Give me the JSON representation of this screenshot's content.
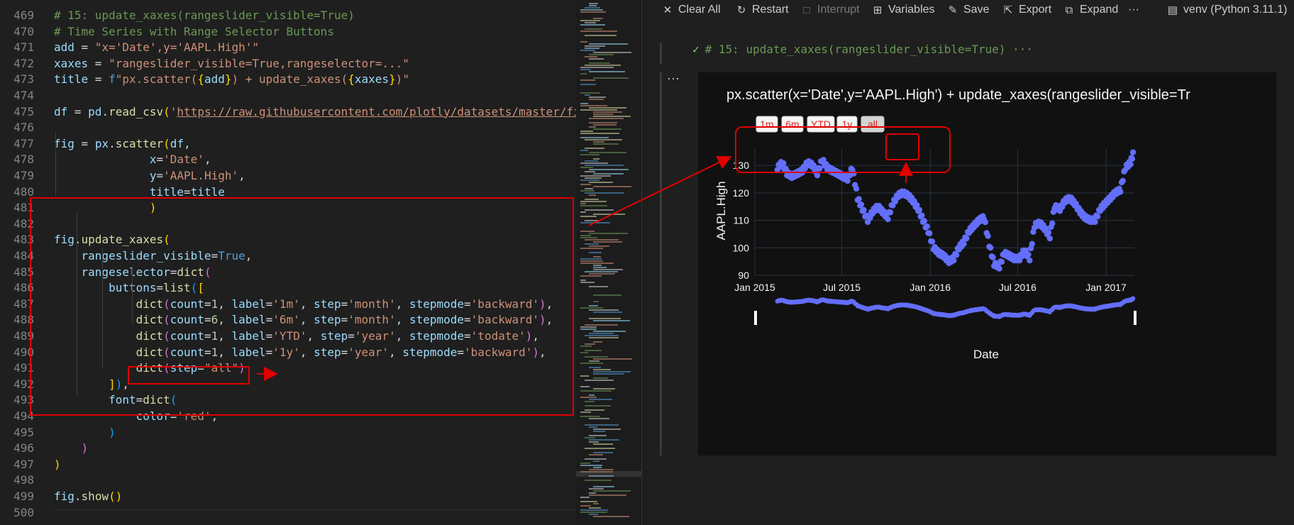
{
  "editor": {
    "lines": [
      {
        "n": "469",
        "tokens": [
          [
            "c-com",
            "# 15: update_xaxes(rangeslider_visible=True)"
          ]
        ]
      },
      {
        "n": "470",
        "tokens": [
          [
            "c-com",
            "# Time Series with Range Selector Buttons"
          ]
        ]
      },
      {
        "n": "471",
        "tokens": [
          [
            "c-var",
            "add"
          ],
          [
            "c-op",
            " = "
          ],
          [
            "c-str",
            "\"x='Date',y='AAPL.High'\""
          ]
        ]
      },
      {
        "n": "472",
        "tokens": [
          [
            "c-var",
            "xaxes"
          ],
          [
            "c-op",
            " = "
          ],
          [
            "c-str",
            "\"rangeslider_visible=True,rangeselector=...\""
          ]
        ]
      },
      {
        "n": "473",
        "tokens": [
          [
            "c-var",
            "title"
          ],
          [
            "c-op",
            " = "
          ],
          [
            "c-kw",
            "f"
          ],
          [
            "c-str",
            "\"px.scatter("
          ],
          [
            "c-br1",
            "{"
          ],
          [
            "c-var",
            "add"
          ],
          [
            "c-br1",
            "}"
          ],
          [
            "c-str",
            ") + update_xaxes("
          ],
          [
            "c-br1",
            "{"
          ],
          [
            "c-var",
            "xaxes"
          ],
          [
            "c-br1",
            "}"
          ],
          [
            "c-str",
            ")\""
          ]
        ]
      },
      {
        "n": "474",
        "tokens": []
      },
      {
        "n": "475",
        "tokens": [
          [
            "c-var",
            "df"
          ],
          [
            "c-op",
            " = "
          ],
          [
            "c-var",
            "pd"
          ],
          [
            "c-op",
            "."
          ],
          [
            "c-fn",
            "read_csv"
          ],
          [
            "c-br1",
            "("
          ],
          [
            "c-str",
            "'"
          ],
          [
            "c-url",
            "https://raw.githubusercontent.com/plotly/datasets/master/finan"
          ]
        ]
      },
      {
        "n": "476",
        "tokens": []
      },
      {
        "n": "477",
        "tokens": [
          [
            "c-var",
            "fig"
          ],
          [
            "c-op",
            " = "
          ],
          [
            "c-var",
            "px"
          ],
          [
            "c-op",
            "."
          ],
          [
            "c-fn",
            "scatter"
          ],
          [
            "c-br1",
            "("
          ],
          [
            "c-var",
            "df"
          ],
          [
            "c-op",
            ","
          ]
        ]
      },
      {
        "n": "478",
        "tokens": [
          [
            "c-op",
            "              "
          ],
          [
            "c-var",
            "x"
          ],
          [
            "c-op",
            "="
          ],
          [
            "c-str",
            "'Date'"
          ],
          [
            "c-op",
            ","
          ]
        ]
      },
      {
        "n": "479",
        "tokens": [
          [
            "c-op",
            "              "
          ],
          [
            "c-var",
            "y"
          ],
          [
            "c-op",
            "="
          ],
          [
            "c-str",
            "'AAPL.High'"
          ],
          [
            "c-op",
            ","
          ]
        ]
      },
      {
        "n": "480",
        "tokens": [
          [
            "c-op",
            "              "
          ],
          [
            "c-var",
            "title"
          ],
          [
            "c-op",
            "="
          ],
          [
            "c-var",
            "title"
          ]
        ]
      },
      {
        "n": "481",
        "tokens": [
          [
            "c-op",
            "              "
          ],
          [
            "c-br1",
            ")"
          ]
        ]
      },
      {
        "n": "482",
        "tokens": []
      },
      {
        "n": "483",
        "tokens": [
          [
            "c-var",
            "fig"
          ],
          [
            "c-op",
            "."
          ],
          [
            "c-fn",
            "update_xaxes"
          ],
          [
            "c-br1",
            "("
          ]
        ]
      },
      {
        "n": "484",
        "tokens": [
          [
            "c-op",
            "    "
          ],
          [
            "c-var",
            "rangeslider_visible"
          ],
          [
            "c-op",
            "="
          ],
          [
            "c-kw",
            "True"
          ],
          [
            "c-op",
            ","
          ]
        ]
      },
      {
        "n": "485",
        "tokens": [
          [
            "c-op",
            "    "
          ],
          [
            "c-var",
            "rangeselector"
          ],
          [
            "c-op",
            "="
          ],
          [
            "c-fn",
            "dict"
          ],
          [
            "c-br2",
            "("
          ]
        ]
      },
      {
        "n": "486",
        "tokens": [
          [
            "c-op",
            "        "
          ],
          [
            "c-var",
            "buttons"
          ],
          [
            "c-op",
            "="
          ],
          [
            "c-fn",
            "list"
          ],
          [
            "c-br3",
            "("
          ],
          [
            "c-br1",
            "["
          ]
        ]
      },
      {
        "n": "487",
        "tokens": [
          [
            "c-op",
            "            "
          ],
          [
            "c-fn",
            "dict"
          ],
          [
            "c-br2",
            "("
          ],
          [
            "c-var",
            "count"
          ],
          [
            "c-op",
            "="
          ],
          [
            "c-num",
            "1"
          ],
          [
            "c-op",
            ", "
          ],
          [
            "c-var",
            "label"
          ],
          [
            "c-op",
            "="
          ],
          [
            "c-str",
            "'1m'"
          ],
          [
            "c-op",
            ", "
          ],
          [
            "c-var",
            "step"
          ],
          [
            "c-op",
            "="
          ],
          [
            "c-str",
            "'month'"
          ],
          [
            "c-op",
            ", "
          ],
          [
            "c-var",
            "stepmode"
          ],
          [
            "c-op",
            "="
          ],
          [
            "c-str",
            "'backward'"
          ],
          [
            "c-br2",
            ")"
          ],
          [
            "c-op",
            ","
          ]
        ]
      },
      {
        "n": "488",
        "tokens": [
          [
            "c-op",
            "            "
          ],
          [
            "c-fn",
            "dict"
          ],
          [
            "c-br2",
            "("
          ],
          [
            "c-var",
            "count"
          ],
          [
            "c-op",
            "="
          ],
          [
            "c-num",
            "6"
          ],
          [
            "c-op",
            ", "
          ],
          [
            "c-var",
            "label"
          ],
          [
            "c-op",
            "="
          ],
          [
            "c-str",
            "'6m'"
          ],
          [
            "c-op",
            ", "
          ],
          [
            "c-var",
            "step"
          ],
          [
            "c-op",
            "="
          ],
          [
            "c-str",
            "'month'"
          ],
          [
            "c-op",
            ", "
          ],
          [
            "c-var",
            "stepmode"
          ],
          [
            "c-op",
            "="
          ],
          [
            "c-str",
            "'backward'"
          ],
          [
            "c-br2",
            ")"
          ],
          [
            "c-op",
            ","
          ]
        ]
      },
      {
        "n": "489",
        "tokens": [
          [
            "c-op",
            "            "
          ],
          [
            "c-fn",
            "dict"
          ],
          [
            "c-br2",
            "("
          ],
          [
            "c-var",
            "count"
          ],
          [
            "c-op",
            "="
          ],
          [
            "c-num",
            "1"
          ],
          [
            "c-op",
            ", "
          ],
          [
            "c-var",
            "label"
          ],
          [
            "c-op",
            "="
          ],
          [
            "c-str",
            "'YTD'"
          ],
          [
            "c-op",
            ", "
          ],
          [
            "c-var",
            "step"
          ],
          [
            "c-op",
            "="
          ],
          [
            "c-str",
            "'year'"
          ],
          [
            "c-op",
            ", "
          ],
          [
            "c-var",
            "stepmode"
          ],
          [
            "c-op",
            "="
          ],
          [
            "c-str",
            "'todate'"
          ],
          [
            "c-br2",
            ")"
          ],
          [
            "c-op",
            ","
          ]
        ]
      },
      {
        "n": "490",
        "tokens": [
          [
            "c-op",
            "            "
          ],
          [
            "c-fn",
            "dict"
          ],
          [
            "c-br2",
            "("
          ],
          [
            "c-var",
            "count"
          ],
          [
            "c-op",
            "="
          ],
          [
            "c-num",
            "1"
          ],
          [
            "c-op",
            ", "
          ],
          [
            "c-var",
            "label"
          ],
          [
            "c-op",
            "="
          ],
          [
            "c-str",
            "'1y'"
          ],
          [
            "c-op",
            ", "
          ],
          [
            "c-var",
            "step"
          ],
          [
            "c-op",
            "="
          ],
          [
            "c-str",
            "'year'"
          ],
          [
            "c-op",
            ", "
          ],
          [
            "c-var",
            "stepmode"
          ],
          [
            "c-op",
            "="
          ],
          [
            "c-str",
            "'backward'"
          ],
          [
            "c-br2",
            ")"
          ],
          [
            "c-op",
            ","
          ]
        ]
      },
      {
        "n": "491",
        "tokens": [
          [
            "c-op",
            "            "
          ],
          [
            "c-fn",
            "dict"
          ],
          [
            "c-br2",
            "("
          ],
          [
            "c-var",
            "step"
          ],
          [
            "c-op",
            "="
          ],
          [
            "c-str",
            "\"all\""
          ],
          [
            "c-br2",
            ")"
          ]
        ]
      },
      {
        "n": "492",
        "tokens": [
          [
            "c-op",
            "        "
          ],
          [
            "c-br1",
            "]"
          ],
          [
            "c-br3",
            ")"
          ],
          [
            "c-op",
            ","
          ]
        ]
      },
      {
        "n": "493",
        "tokens": [
          [
            "c-op",
            "        "
          ],
          [
            "c-var",
            "font"
          ],
          [
            "c-op",
            "="
          ],
          [
            "c-fn",
            "dict"
          ],
          [
            "c-br3",
            "("
          ]
        ]
      },
      {
        "n": "494",
        "tokens": [
          [
            "c-op",
            "            "
          ],
          [
            "c-var",
            "color"
          ],
          [
            "c-op",
            "="
          ],
          [
            "c-str",
            "'red'"
          ],
          [
            "c-op",
            ","
          ]
        ]
      },
      {
        "n": "495",
        "tokens": [
          [
            "c-op",
            "        "
          ],
          [
            "c-br3",
            ")"
          ]
        ]
      },
      {
        "n": "496",
        "tokens": [
          [
            "c-op",
            "    "
          ],
          [
            "c-br2",
            ")"
          ]
        ]
      },
      {
        "n": "497",
        "tokens": [
          [
            "c-br1",
            ")"
          ]
        ]
      },
      {
        "n": "498",
        "tokens": []
      },
      {
        "n": "499",
        "tokens": [
          [
            "c-var",
            "fig"
          ],
          [
            "c-op",
            "."
          ],
          [
            "c-fn",
            "show"
          ],
          [
            "c-br1",
            "()"
          ]
        ]
      },
      {
        "n": "500",
        "tokens": []
      }
    ]
  },
  "toolbar": {
    "clear_all": "Clear All",
    "restart": "Restart",
    "interrupt": "Interrupt",
    "variables": "Variables",
    "save": "Save",
    "export": "Export",
    "expand": "Expand",
    "more": "···",
    "kernel": "venv (Python 3.11.1)"
  },
  "cell": {
    "status_icon": "check-icon",
    "header": "# 15: update_xaxes(rangeslider_visible=True) ···",
    "output_menu": "···"
  },
  "colors": {
    "marker": "#636efa",
    "button_text": "#e02020",
    "annotation": "#e00000",
    "plot_bg": "#111111",
    "grid": "#283442"
  },
  "chart_data": {
    "type": "scatter",
    "title": "px.scatter(x='Date',y='AAPL.High') + update_xaxes(rangeslider_visible=Tr",
    "xlabel": "Date",
    "ylabel": "AAPL.High",
    "xlim": [
      "2015-01-01",
      "2017-03-01"
    ],
    "ylim": [
      90,
      136
    ],
    "x_ticks": [
      "Jan 2015",
      "Jul 2015",
      "Jan 2016",
      "Jul 2016",
      "Jan 2017"
    ],
    "y_ticks": [
      90,
      100,
      110,
      120,
      130
    ],
    "range_buttons": [
      "1m",
      "6m",
      "YTD",
      "1y",
      "all"
    ],
    "active_button": "all",
    "rangeslider_visible": true,
    "series": [
      {
        "x": [
          "2015-02-17",
          "2015-02-27",
          "2015-03-09",
          "2015-03-19",
          "2015-03-31",
          "2015-04-10",
          "2015-04-21",
          "2015-05-01",
          "2015-05-11",
          "2015-05-21",
          "2015-06-01",
          "2015-06-11",
          "2015-06-22",
          "2015-07-02",
          "2015-07-13",
          "2015-07-23",
          "2015-08-03",
          "2015-08-13",
          "2015-08-24",
          "2015-09-03",
          "2015-09-14",
          "2015-09-24",
          "2015-10-05",
          "2015-10-15",
          "2015-10-26",
          "2015-11-05",
          "2015-11-16",
          "2015-11-26",
          "2015-12-07",
          "2015-12-17",
          "2015-12-28",
          "2016-01-08",
          "2016-01-19",
          "2016-01-29",
          "2016-02-09",
          "2016-02-19",
          "2016-03-01",
          "2016-03-11",
          "2016-03-22",
          "2016-04-01",
          "2016-04-12",
          "2016-04-22",
          "2016-05-03",
          "2016-05-13",
          "2016-05-24",
          "2016-06-03",
          "2016-06-14",
          "2016-06-24",
          "2016-07-05",
          "2016-07-15",
          "2016-07-26",
          "2016-08-05",
          "2016-08-16",
          "2016-08-26",
          "2016-09-06",
          "2016-09-16",
          "2016-09-27",
          "2016-10-07",
          "2016-10-18",
          "2016-10-28",
          "2016-11-08",
          "2016-11-18",
          "2016-11-29",
          "2016-12-09",
          "2016-12-20",
          "2016-12-30",
          "2017-01-10",
          "2017-01-20",
          "2017-01-31",
          "2017-02-10",
          "2017-02-21",
          "2017-02-28"
        ],
        "y": [
          129,
          131,
          127,
          126,
          127,
          128,
          131,
          130,
          127,
          132,
          129,
          128,
          127,
          126,
          125,
          129,
          118,
          114,
          110,
          113,
          115,
          113,
          111,
          116,
          119,
          120,
          119,
          117,
          114,
          110,
          106,
          100,
          98,
          97,
          95,
          96,
          100,
          102,
          106,
          108,
          110,
          111,
          101,
          94,
          93,
          98,
          97,
          96,
          96,
          99,
          96,
          108,
          109,
          107,
          104,
          115,
          114,
          117,
          118,
          116,
          113,
          111,
          110,
          110,
          114,
          116,
          118,
          120,
          121,
          129,
          131,
          135
        ]
      }
    ]
  }
}
